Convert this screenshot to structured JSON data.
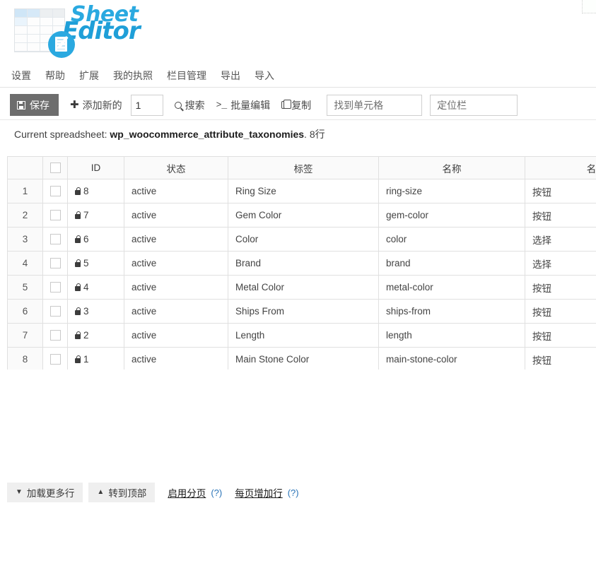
{
  "brand": {
    "name_part1": "Sheet",
    "name_part2": "Editor",
    "color_primary": "#2aa9e0",
    "color_secondary": "#1f9fd8"
  },
  "menubar": {
    "items": [
      {
        "label": "设置"
      },
      {
        "label": "帮助"
      },
      {
        "label": "扩展"
      },
      {
        "label": "我的执照"
      },
      {
        "label": "栏目管理"
      },
      {
        "label": "导出"
      },
      {
        "label": "导入"
      }
    ]
  },
  "toolbar": {
    "save_label": "保存",
    "add_new_label": "添加新的",
    "add_new_count": "1",
    "search_label": "搜索",
    "bulk_edit_label": "批量编辑",
    "bulk_edit_prefix": ">_",
    "duplicate_label": "复制",
    "find_cell_placeholder": "找到单元格",
    "goto_column_placeholder": "定位栏",
    "find_cell_value": "",
    "goto_column_value": ""
  },
  "status": {
    "prefix": "Current spreadsheet: ",
    "spreadsheet_name": "wp_woocommerce_attribute_taxonomies",
    "suffix": ". 8行"
  },
  "table": {
    "headers": [
      {
        "label": ""
      },
      {
        "label": ""
      },
      {
        "label": "ID"
      },
      {
        "label": "状态"
      },
      {
        "label": "标签"
      },
      {
        "label": "名称"
      },
      {
        "label": "名"
      }
    ],
    "rows": [
      {
        "num": "1",
        "id": "8",
        "status": "active",
        "label": "Ring Size",
        "name": "ring-size",
        "type": "按钮"
      },
      {
        "num": "2",
        "id": "7",
        "status": "active",
        "label": "Gem Color",
        "name": "gem-color",
        "type": "按钮"
      },
      {
        "num": "3",
        "id": "6",
        "status": "active",
        "label": "Color",
        "name": "color",
        "type": "选择"
      },
      {
        "num": "4",
        "id": "5",
        "status": "active",
        "label": "Brand",
        "name": "brand",
        "type": "选择"
      },
      {
        "num": "5",
        "id": "4",
        "status": "active",
        "label": "Metal Color",
        "name": "metal-color",
        "type": "按钮"
      },
      {
        "num": "6",
        "id": "3",
        "status": "active",
        "label": "Ships From",
        "name": "ships-from",
        "type": "按钮"
      },
      {
        "num": "7",
        "id": "2",
        "status": "active",
        "label": "Length",
        "name": "length",
        "type": "按钮"
      },
      {
        "num": "8",
        "id": "1",
        "status": "active",
        "label": "Main Stone Color",
        "name": "main-stone-color",
        "type": "按钮"
      }
    ]
  },
  "bottom": {
    "load_more_label": "加载更多行",
    "go_top_label": "转到顶部",
    "enable_paging_label": "启用分页",
    "enable_paging_help": "(?)",
    "rows_per_page_label": "每页增加行",
    "rows_per_page_help": "(?)"
  }
}
